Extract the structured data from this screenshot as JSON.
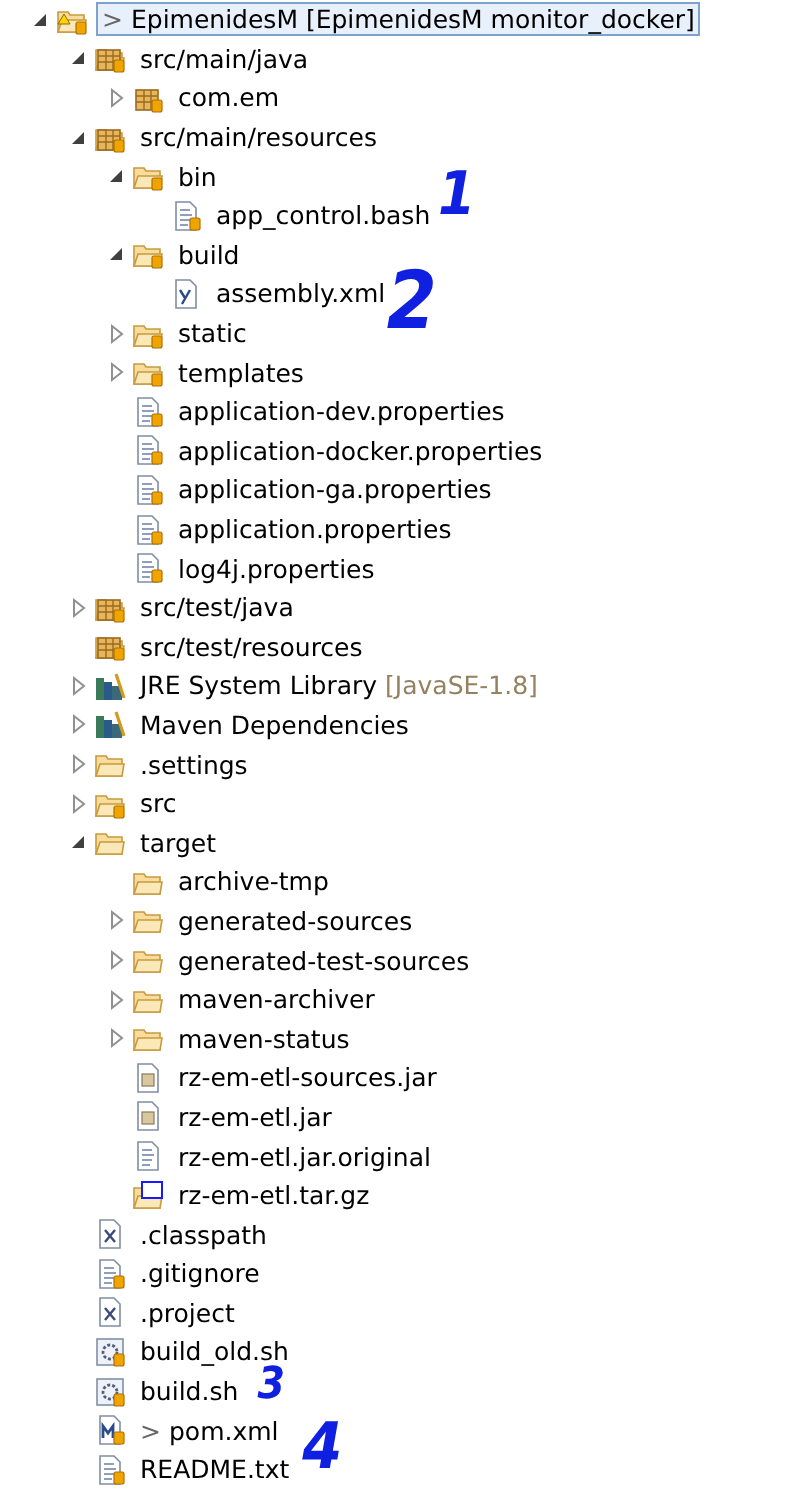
{
  "tree": [
    {
      "label": "EpimenidesM [EpimenidesM monitor_docker]",
      "prefix": ">",
      "kind": "project",
      "expanded": true,
      "selected": true,
      "children": [
        {
          "label": "src/main/java",
          "kind": "source-folder",
          "expanded": true,
          "selected": false,
          "children": [
            {
              "label": "com.em",
              "kind": "package",
              "expanded": false,
              "selected": false
            }
          ]
        },
        {
          "label": "src/main/resources",
          "kind": "source-folder",
          "expanded": true,
          "selected": false,
          "children": [
            {
              "label": "bin",
              "kind": "folder",
              "expanded": true,
              "selected": false,
              "children": [
                {
                  "label": "app_control.bash",
                  "kind": "text-file",
                  "selected": false
                }
              ]
            },
            {
              "label": "build",
              "kind": "folder",
              "expanded": true,
              "selected": false,
              "children": [
                {
                  "label": "assembly.xml",
                  "kind": "xml-file",
                  "selected": false
                }
              ]
            },
            {
              "label": "static",
              "kind": "folder",
              "expanded": false,
              "selected": false
            },
            {
              "label": "templates",
              "kind": "folder",
              "expanded": false,
              "selected": false
            },
            {
              "label": "application-dev.properties",
              "kind": "text-file",
              "selected": false
            },
            {
              "label": "application-docker.properties",
              "kind": "text-file",
              "selected": false
            },
            {
              "label": "application-ga.properties",
              "kind": "text-file",
              "selected": false
            },
            {
              "label": "application.properties",
              "kind": "text-file",
              "selected": false
            },
            {
              "label": "log4j.properties",
              "kind": "text-file",
              "selected": false
            }
          ]
        },
        {
          "label": "src/test/java",
          "kind": "source-folder",
          "expanded": false,
          "selected": false
        },
        {
          "label": "src/test/resources",
          "kind": "source-folder",
          "selected": false
        },
        {
          "label": "JRE System Library",
          "decoration": "[JavaSE-1.8]",
          "kind": "library",
          "expanded": false,
          "selected": false
        },
        {
          "label": "Maven Dependencies",
          "kind": "library",
          "expanded": false,
          "selected": false
        },
        {
          "label": ".settings",
          "kind": "plain-folder",
          "expanded": false,
          "selected": false
        },
        {
          "label": "src",
          "kind": "folder",
          "expanded": false,
          "selected": false
        },
        {
          "label": "target",
          "kind": "plain-folder",
          "expanded": true,
          "selected": false,
          "children": [
            {
              "label": "archive-tmp",
              "kind": "plain-folder",
              "selected": false
            },
            {
              "label": "generated-sources",
              "kind": "plain-folder",
              "expanded": false,
              "selected": false
            },
            {
              "label": "generated-test-sources",
              "kind": "plain-folder",
              "expanded": false,
              "selected": false
            },
            {
              "label": "maven-archiver",
              "kind": "plain-folder",
              "expanded": false,
              "selected": false
            },
            {
              "label": "maven-status",
              "kind": "plain-folder",
              "expanded": false,
              "selected": false
            },
            {
              "label": "rz-em-etl-sources.jar",
              "kind": "jar-file",
              "selected": false
            },
            {
              "label": "rz-em-etl.jar",
              "kind": "jar-file",
              "selected": false
            },
            {
              "label": "rz-em-etl.jar.original",
              "kind": "plain-file",
              "selected": false
            },
            {
              "label": "rz-em-etl.tar.gz",
              "kind": "archive-file",
              "selected": false
            }
          ]
        },
        {
          "label": ".classpath",
          "kind": "x-file",
          "selected": false
        },
        {
          "label": ".gitignore",
          "kind": "text-file",
          "selected": false
        },
        {
          "label": ".project",
          "kind": "x-file",
          "selected": false
        },
        {
          "label": "build_old.sh",
          "kind": "script-file",
          "selected": false
        },
        {
          "label": "build.sh",
          "kind": "script-file",
          "selected": false
        },
        {
          "label": "pom.xml",
          "prefix": ">",
          "kind": "maven-file",
          "selected": false
        },
        {
          "label": "README.txt",
          "kind": "text-file",
          "selected": false
        }
      ]
    }
  ],
  "annotations": [
    {
      "text": "1",
      "kind": "top"
    },
    {
      "text": "2",
      "kind": "upper"
    },
    {
      "text": "3",
      "kind": "lower"
    },
    {
      "text": "4",
      "kind": "bottom"
    }
  ]
}
